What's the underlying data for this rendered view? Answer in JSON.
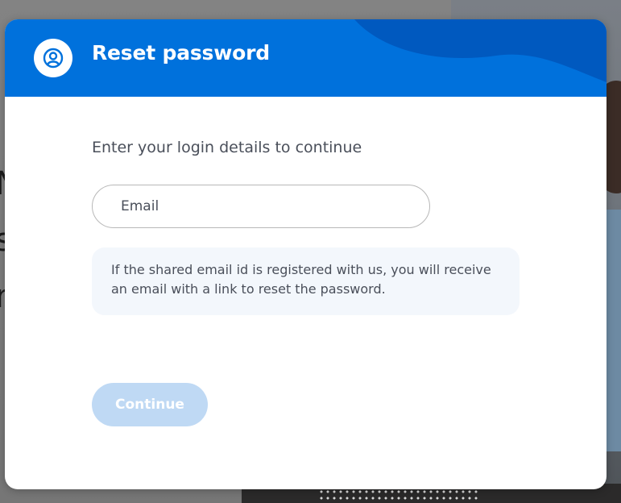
{
  "modal": {
    "title": "Reset password",
    "header_icon": "user-circle-icon",
    "instructions": "Enter your login details to continue",
    "email_field": {
      "placeholder": "Email",
      "value": ""
    },
    "info_message": "If the shared email id is registered with us, you will receive an email with a link to reset the password.",
    "continue_label": "Continue",
    "continue_enabled": false
  },
  "colors": {
    "header_blue": "#0071dc",
    "header_wave": "#0059bf",
    "button_disabled": "#bfd9f4",
    "info_bg": "#f3f7fc",
    "text_gray": "#4a4f5a"
  }
}
